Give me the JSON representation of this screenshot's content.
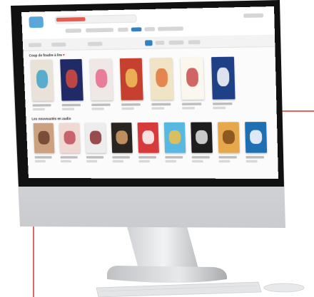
{
  "screen": {
    "section1_title": "Coup de foudre à lire",
    "section2_title": "Les nouveautés en audio"
  },
  "colors": {
    "accent": "#e65a4f",
    "brand_blue": "#2f80c4",
    "pointer_line": "#e56566"
  },
  "books_row1": [
    {
      "color": "#e9e2d8",
      "accent": "#3da3c9"
    },
    {
      "color": "#1f2a66",
      "accent": "#d94a3d"
    },
    {
      "color": "#efe8e6",
      "accent": "#e56a8a"
    },
    {
      "color": "#c6402f",
      "accent": "#f0c35a"
    },
    {
      "color": "#f1e4c4",
      "accent": "#e0763b"
    },
    {
      "color": "#fbf7ef",
      "accent": "#c94b4b"
    },
    {
      "color": "#1f3f86",
      "accent": "#ffffff"
    }
  ],
  "books_row2": [
    {
      "color": "#cda07f",
      "accent": "#6a3f2b"
    },
    {
      "color": "#f0d9d3",
      "accent": "#c04d5b"
    },
    {
      "color": "#ededed",
      "accent": "#8b2f2f"
    },
    {
      "color": "#2a2420",
      "accent": "#d9a16b"
    },
    {
      "color": "#d63a3a",
      "accent": "#ffffff"
    },
    {
      "color": "#59b8e0",
      "accent": "#f1c04a"
    },
    {
      "color": "#1d1d1d",
      "accent": "#e8e8e8"
    },
    {
      "color": "#e6a84b",
      "accent": "#7a4b1a"
    },
    {
      "color": "#1f6fb3",
      "accent": "#ffffff"
    }
  ]
}
